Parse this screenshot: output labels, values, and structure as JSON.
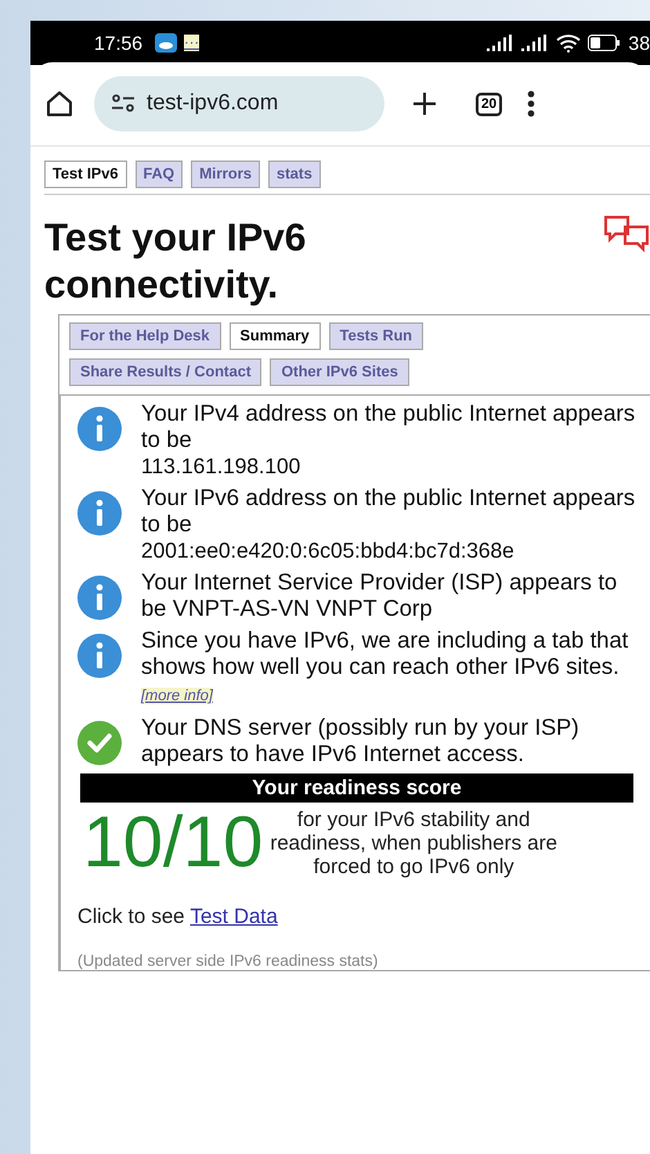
{
  "status_bar": {
    "time": "17:56",
    "more": "···",
    "battery": "38"
  },
  "browser": {
    "url": "test-ipv6.com",
    "tab_count": "20"
  },
  "site_nav": [
    {
      "label": "Test IPv6",
      "selected": true
    },
    {
      "label": "FAQ",
      "selected": false
    },
    {
      "label": "Mirrors",
      "selected": false
    },
    {
      "label": "stats",
      "selected": false
    }
  ],
  "title": "Test your IPv6 connectivity.",
  "result_tabs": [
    {
      "label": "For the Help Desk",
      "selected": false
    },
    {
      "label": "Summary",
      "selected": true
    },
    {
      "label": "Tests Run",
      "selected": false
    },
    {
      "label": "Share Results / Contact",
      "selected": false
    },
    {
      "label": "Other IPv6 Sites",
      "selected": false
    }
  ],
  "messages": [
    {
      "kind": "info",
      "text": "Your IPv4 address on the public Internet appears to be",
      "detail": "113.161.198.100"
    },
    {
      "kind": "info",
      "text": "Your IPv6 address on the public Internet appears to be",
      "detail": "2001:ee0:e420:0:6c05:bbd4:bc7d:368e"
    },
    {
      "kind": "info",
      "text": "Your Internet Service Provider (ISP) appears to be VNPT-AS-VN VNPT Corp"
    },
    {
      "kind": "info",
      "text": "Since you have IPv6, we are including a tab that shows how well you can reach other IPv6 sites.",
      "link": "[more info]"
    },
    {
      "kind": "ok",
      "text": "Your DNS server (possibly run by your ISP) appears to have IPv6 Internet access."
    }
  ],
  "readiness": {
    "heading": "Your readiness score",
    "score": "10/10",
    "description": "for your IPv6 stability and readiness, when publishers are forced to go IPv6 only"
  },
  "test_data": {
    "text": "Click to see",
    "link": "Test Data"
  },
  "footnote": "(Updated server side IPv6 readiness stats)"
}
